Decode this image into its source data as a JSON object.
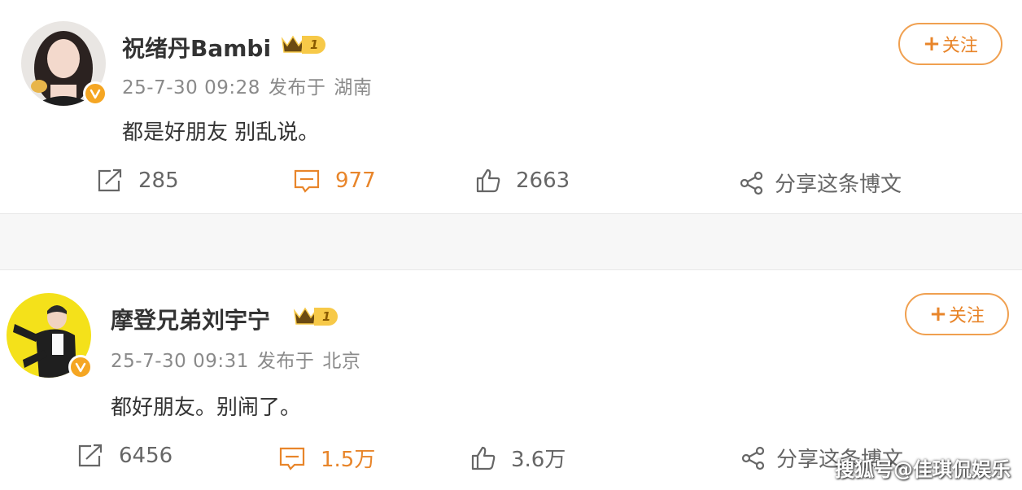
{
  "posts": [
    {
      "username": "祝绪丹Bambi",
      "vip_level": "1",
      "time": "25-7-30 09:28",
      "published_label": "发布于",
      "location": "湖南",
      "content": "都是好朋友 别乱说。",
      "follow_label": "关注",
      "follow_plus": "+",
      "reposts": "285",
      "comments": "977",
      "likes": "2663",
      "share_label": "分享这条博文"
    },
    {
      "username": "摩登兄弟刘宇宁",
      "vip_level": "1",
      "time": "25-7-30 09:31",
      "published_label": "发布于",
      "location": "北京",
      "content": "都好朋友。别闹了。",
      "follow_label": "关注",
      "follow_plus": "+",
      "reposts": "6456",
      "comments": "1.5万",
      "likes": "3.6万",
      "share_label": "分享这条博文"
    }
  ],
  "watermark": "搜狐号@佳琪侃娱乐",
  "colors": {
    "accent": "#e8852a",
    "badge": "#f5a623",
    "vip": "#f7c948"
  }
}
